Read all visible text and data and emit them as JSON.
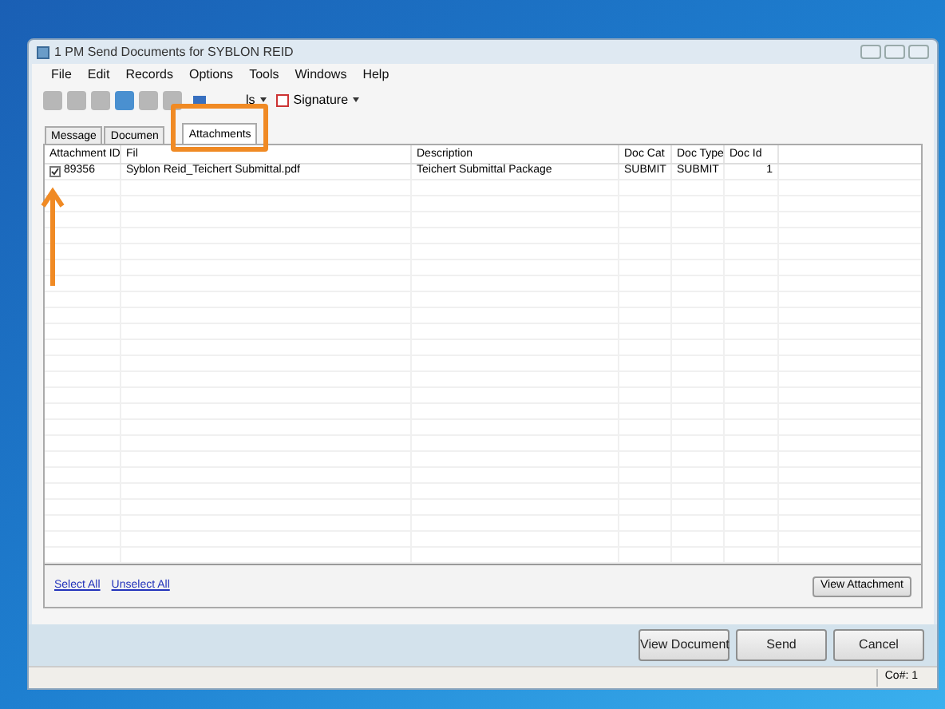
{
  "window": {
    "title": "1 PM Send Documents for SYBLON REID"
  },
  "menu": [
    "File",
    "Edit",
    "Records",
    "Options",
    "Tools",
    "Windows",
    "Help"
  ],
  "toolbar": {
    "partial_label": "ls",
    "signature": "Signature"
  },
  "tabs": [
    {
      "label": "Message",
      "selected": false
    },
    {
      "label": "Documen",
      "selected": false
    },
    {
      "label": "Attachments",
      "selected": true
    }
  ],
  "table": {
    "columns": [
      "Attachment ID",
      "Fil",
      "Description",
      "Doc Cat",
      "Doc Type",
      "Doc Id"
    ],
    "rows": [
      {
        "checked": true,
        "cells": [
          "89356",
          "Syblon Reid_Teichert Submittal.pdf",
          "Teichert Submittal Package",
          "SUBMIT",
          "SUBMIT",
          "1"
        ]
      }
    ]
  },
  "links": [
    "Select All",
    "Unselect All"
  ],
  "view_attachment": "View Attachment",
  "buttons": [
    "View Document",
    "Send",
    "Cancel"
  ],
  "status_bar": "Co#: 1"
}
